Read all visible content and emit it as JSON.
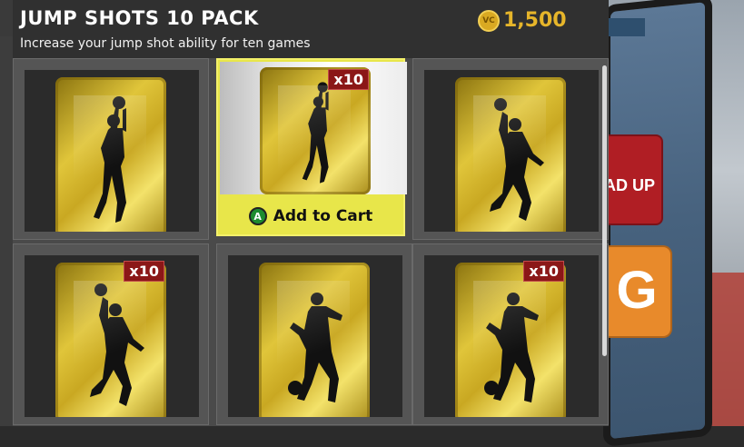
{
  "header": {
    "title": "JUMP SHOTS 10 PACK",
    "subtitle": "Increase your jump shot ability for ten games",
    "price": "1,500",
    "currency_icon": "vc-coin-icon",
    "currency_label": "VC"
  },
  "cards": [
    {
      "badge": "",
      "pose": "jumpshot",
      "selected": false
    },
    {
      "badge": "x10",
      "pose": "jumpshot",
      "selected": true,
      "cta_label": "Add to Cart",
      "cta_button": "A"
    },
    {
      "badge": "",
      "pose": "dunk",
      "selected": false
    },
    {
      "badge": "x10",
      "pose": "dunk",
      "selected": false
    },
    {
      "badge": "",
      "pose": "dribble",
      "selected": false
    },
    {
      "badge": "x10",
      "pose": "dribble",
      "selected": false
    }
  ],
  "background": {
    "tile_red_text": "AD UP",
    "tile_orange_text": "G"
  },
  "colors": {
    "accent_gold": "#e6b52a",
    "selected_highlight": "#e8e64a",
    "badge_red": "#8b1717",
    "button_a_green": "#1e8c2f"
  }
}
